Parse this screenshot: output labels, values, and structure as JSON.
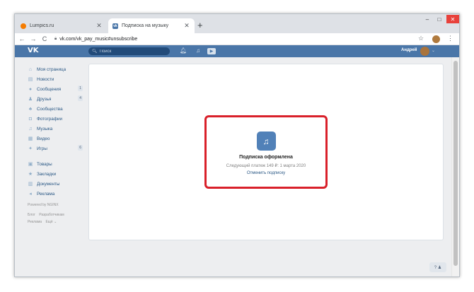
{
  "browser": {
    "tabs": [
      {
        "title": "Lumpics.ru",
        "close": "✕"
      },
      {
        "title": "Подписка на музыку",
        "close": "✕"
      }
    ],
    "new_tab": "+",
    "window": {
      "minimize": "–",
      "maximize": "□",
      "close": "✕"
    },
    "nav": {
      "back": "←",
      "forward": "→",
      "reload": "C"
    },
    "url": "vk.com/vk_pay_music#unsubscribe",
    "bookmark_star": "☆",
    "menu": "⋮"
  },
  "vk_header": {
    "logo": "VK",
    "search_placeholder": "Поиск",
    "user_name": "Андрей",
    "chevron": "⌄"
  },
  "sidebar": {
    "items": [
      {
        "label": "Моя страница",
        "icon": "home-icon",
        "glyph": "⌂"
      },
      {
        "label": "Новости",
        "icon": "news-icon",
        "glyph": "▤"
      },
      {
        "label": "Сообщения",
        "icon": "messages-icon",
        "glyph": "●",
        "count": "1"
      },
      {
        "label": "Друзья",
        "icon": "friends-icon",
        "glyph": "♟",
        "count": "4"
      },
      {
        "label": "Сообщества",
        "icon": "communities-icon",
        "glyph": "♣"
      },
      {
        "label": "Фотографии",
        "icon": "photos-icon",
        "glyph": "◘"
      },
      {
        "label": "Музыка",
        "icon": "music-icon",
        "glyph": "♫"
      },
      {
        "label": "Видео",
        "icon": "video-icon",
        "glyph": "▦"
      },
      {
        "label": "Игры",
        "icon": "games-icon",
        "glyph": "✦",
        "count": "6"
      }
    ],
    "items2": [
      {
        "label": "Товары",
        "icon": "goods-icon",
        "glyph": "▣"
      },
      {
        "label": "Закладки",
        "icon": "bookmarks-icon",
        "glyph": "★"
      },
      {
        "label": "Документы",
        "icon": "documents-icon",
        "glyph": "▥"
      },
      {
        "label": "Реклама",
        "icon": "ads-icon",
        "glyph": "◂"
      }
    ],
    "powered_by": "Powered by NGINX",
    "footer": {
      "blog": "Блог",
      "developers": "Разработчикам",
      "ads": "Реклама",
      "more": "Ещё ⌄"
    }
  },
  "card": {
    "title": "Подписка оформлена",
    "next_payment": "Следующий платеж 149 ₽: 1 марта 2020",
    "cancel_link": "Отменить подписку"
  },
  "help_button": "? ♟"
}
